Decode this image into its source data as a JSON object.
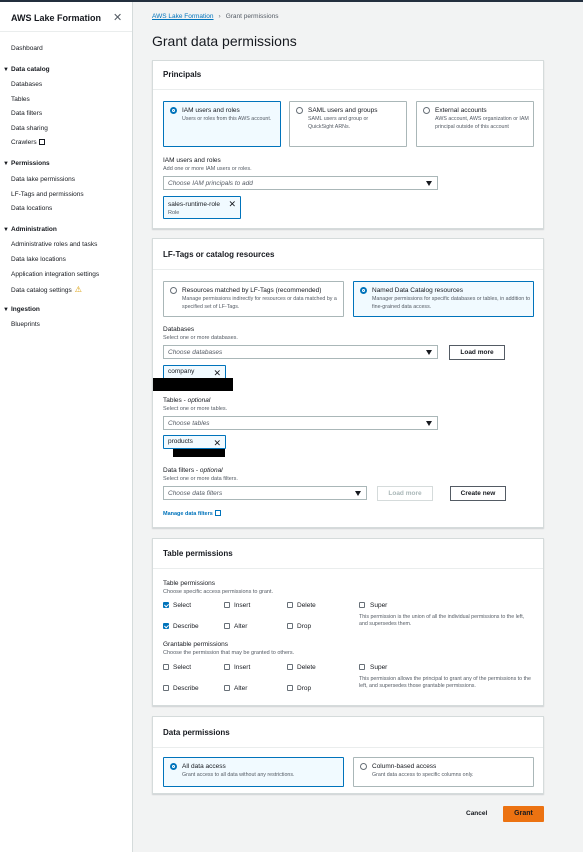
{
  "sidebar": {
    "title": "AWS Lake Formation",
    "dashboard": "Dashboard",
    "sections": [
      {
        "label": "Data catalog",
        "items": [
          "Databases",
          "Tables",
          "Data filters",
          "Data sharing",
          "Crawlers"
        ]
      },
      {
        "label": "Permissions",
        "items": [
          "Data lake permissions",
          "LF-Tags and permissions",
          "Data locations"
        ]
      },
      {
        "label": "Administration",
        "items": [
          "Administrative roles and tasks",
          "Data lake locations",
          "Application integration settings",
          "Data catalog settings"
        ]
      },
      {
        "label": "Ingestion",
        "items": [
          "Blueprints"
        ]
      }
    ]
  },
  "breadcrumb": {
    "root": "AWS Lake Formation",
    "current": "Grant permissions"
  },
  "page_title": "Grant data permissions",
  "principals": {
    "heading": "Principals",
    "options": [
      {
        "title": "IAM users and roles",
        "desc": "Users or roles from this AWS account.",
        "selected": true
      },
      {
        "title": "SAML users and groups",
        "desc": "SAML users and group or QuickSight ARNs.",
        "selected": false
      },
      {
        "title": "External accounts",
        "desc": "AWS account, AWS organization or IAM principal outside of this account",
        "selected": false
      }
    ],
    "field_label": "IAM users and roles",
    "field_hint": "Add one or more IAM users or roles.",
    "placeholder": "Choose IAM principals to add",
    "token_name": "sales-runtime-role",
    "token_type": "Role"
  },
  "lf": {
    "heading": "LF-Tags or catalog resources",
    "options": [
      {
        "title": "Resources matched by LF-Tags (recommended)",
        "desc": "Manage permissions indirectly for resources or data matched by a specified set of LF-Tags.",
        "selected": false
      },
      {
        "title": "Named Data Catalog resources",
        "desc": "Manager permissions for specific databases or tables, in addition to fine-grained data access.",
        "selected": true
      }
    ],
    "db_label": "Databases",
    "db_hint": "Select one or more databases.",
    "db_placeholder": "Choose databases",
    "load_more": "Load more",
    "db_token": "company",
    "tables_label": "Tables",
    "optional": "optional",
    "tables_hint": "Select one or more tables.",
    "tables_placeholder": "Choose tables",
    "table_token": "products",
    "filters_label": "Data filters",
    "filters_hint": "Select one or more data filters.",
    "filters_placeholder": "Choose data filters",
    "filters_load_more": "Load more",
    "create_new": "Create new",
    "manage_link": "Manage data filters"
  },
  "table_perms": {
    "heading": "Table permissions",
    "tp_label": "Table permissions",
    "tp_hint": "Choose specific access permissions to grant.",
    "select": "Select",
    "insert": "Insert",
    "delete": "Delete",
    "super": "Super",
    "describe": "Describe",
    "alter": "Alter",
    "drop": "Drop",
    "super_note": "This permission is the union of all the individual permissions to the left, and supersedes them.",
    "gp_label": "Grantable permissions",
    "gp_hint": "Choose the permission that may be granted to others.",
    "g_super_note": "This permission allows the principal to grant any of the permissions to the left, and supersedes those grantable permissions.",
    "checked": {
      "select": true,
      "describe": true
    }
  },
  "data_perms": {
    "heading": "Data permissions",
    "options": [
      {
        "title": "All data access",
        "desc": "Grant access to all data without any restrictions.",
        "selected": true
      },
      {
        "title": "Column-based access",
        "desc": "Grant data access to specific columns only.",
        "selected": false
      }
    ]
  },
  "footer": {
    "cancel": "Cancel",
    "grant": "Grant"
  },
  "colors": {
    "accent": "#0073bb",
    "primary_button": "#ec7211",
    "warning": "#d89a00"
  }
}
